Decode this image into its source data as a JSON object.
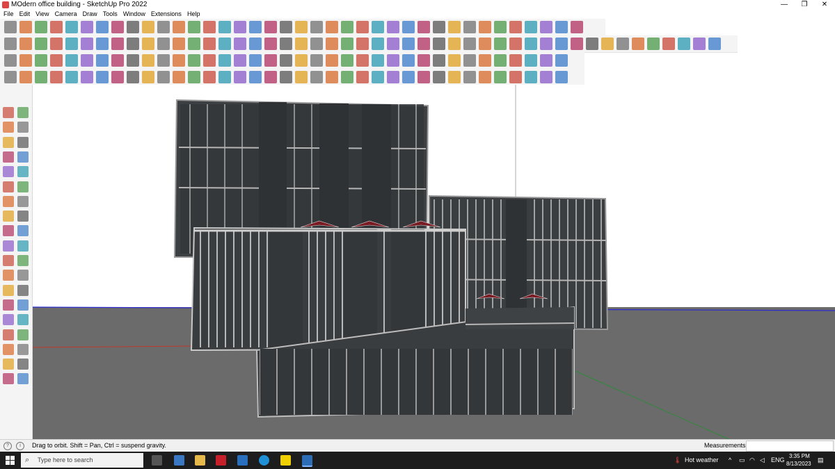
{
  "window": {
    "title": "MOdern office building - SketchUp Pro 2022",
    "minimize": "—",
    "restore": "❐",
    "close": "✕"
  },
  "menu": [
    "File",
    "Edit",
    "View",
    "Camera",
    "Draw",
    "Tools",
    "Window",
    "Extensions",
    "Help"
  ],
  "colors": {
    "toolbar_bg": "#f4f4f4",
    "viewport_bg": "#ffffff",
    "ground": "#6b6b6b",
    "facade": "#3a3d3f",
    "mullion": "#c9c9c9",
    "axis_red": "#c0392b",
    "axis_green": "#2e8b3a",
    "axis_blue": "#2b2bd0",
    "taskbar": "#1d1d1d"
  },
  "status": {
    "hint": "Drag to orbit. Shift = Pan, Ctrl = suspend gravity.",
    "measurements_label": "Measurements",
    "measurements_value": ""
  },
  "taskbar": {
    "search_placeholder": "Type here to search",
    "weather": "Hot weather",
    "language": "ENG",
    "time": "3:35 PM",
    "date": "8/13/2023"
  },
  "icons": {
    "toolbar_rows": 3,
    "left_tools": [
      "select-icon",
      "orbit-icon",
      "paint-bucket-icon",
      "eraser-icon",
      "push-pull-icon",
      "tape-icon",
      "line-icon",
      "freehand-icon",
      "rectangle-icon",
      "rotated-rectangle-icon",
      "circle-icon",
      "polygon-icon",
      "arc-icon",
      "pie-icon",
      "offset-icon",
      "follow-me-icon",
      "move-icon",
      "rotate-icon",
      "scale-icon",
      "flip-icon",
      "tape-measure-icon",
      "text-icon",
      "protractor-icon",
      "label-icon",
      "axes-icon",
      "section-plane-icon",
      "orbit-tool-icon",
      "pan-icon",
      "zoom-icon",
      "zoom-window-icon",
      "zoom-extents-icon",
      "previous-view-icon",
      "walk-icon",
      "look-around-icon",
      "position-camera-icon",
      "sandbox-icon",
      "layers-icon",
      "styles-icon"
    ]
  }
}
